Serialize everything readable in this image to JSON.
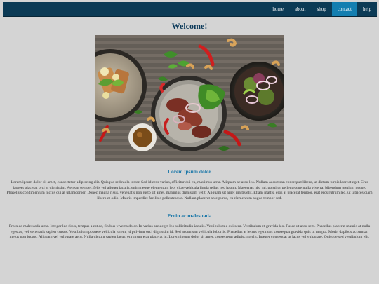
{
  "nav": {
    "items": [
      "home",
      "about",
      "shop",
      "contact",
      "help"
    ],
    "active": "contact"
  },
  "page": {
    "title": "Welcome!"
  },
  "sections": [
    {
      "heading": "Lorem ipsum dolor",
      "text": "Lorem ipsum dolor sit amet, consectetur adipiscing elit. Quisque sed nulla tortor. Sed id eros varius, efficitur dui eu, maximus urna. Aliquam ac arcu leo. Nullam accumsan consequat libero, ut dictum turpis laoreet eget. Cras laoreet placerat orci at dignissim. Aenean semper, felis vel aliquet iaculis, enim neque elementum leo, vitae vehicula ligula tellus nec ipsum. Maecenas nisi mi, porttitor pellentesque nulla viverra, bibendum pretium neque. Phasellus condimentum luctus dui at ullamcorper. Donec magna risus, venenatis non justo sit amet, maximus dignissim velit. Aliquam sit amet mattis elit. Etiam mattis, eros at placerat tempor, erat eros rutrum leo, ut ultrices diam libero et odio. Mauris imperdiet facilisis pellentesque. Nullam placerat ante purus, eu elementum augue tempor sed."
    },
    {
      "heading": "Proin ac malesuada",
      "text": "Proin ac malesuada urna. Integer leo risus, tempus a est ac, finibus viverra dolor. In varius arcu eget leo sollicitudin iaculis. Vestibulum a dui sem. Vestibulum et gravida leo. Fusce ut arcu sem. Phasellus placerat mauris at nulla egestas, vel venenatis sapien cursus. Vestibulum posuere vehicula lorem, id pulvinar orci dignissim id. Sed accumsan vehicula lobortis. Phasellus at lectus eget nunc consequat gravida quis ut magna. Morbi dapibus accumsan metus non luctus. Aliquam vel vulputate arcu. Nulla dictum sapien lacus, et rutrum erat placerat in. Lorem ipsum dolor sit amet, consectetur adipiscing elit. Integer consequat ut lacus vel vulputate. Quisque sed vestibulum elit."
    }
  ],
  "colors": {
    "nav_bg": "#0b3a55",
    "nav_active": "#137eb0",
    "title": "#0c3a5a",
    "heading": "#1a77a8",
    "page_bg": "#d4d4d4"
  }
}
